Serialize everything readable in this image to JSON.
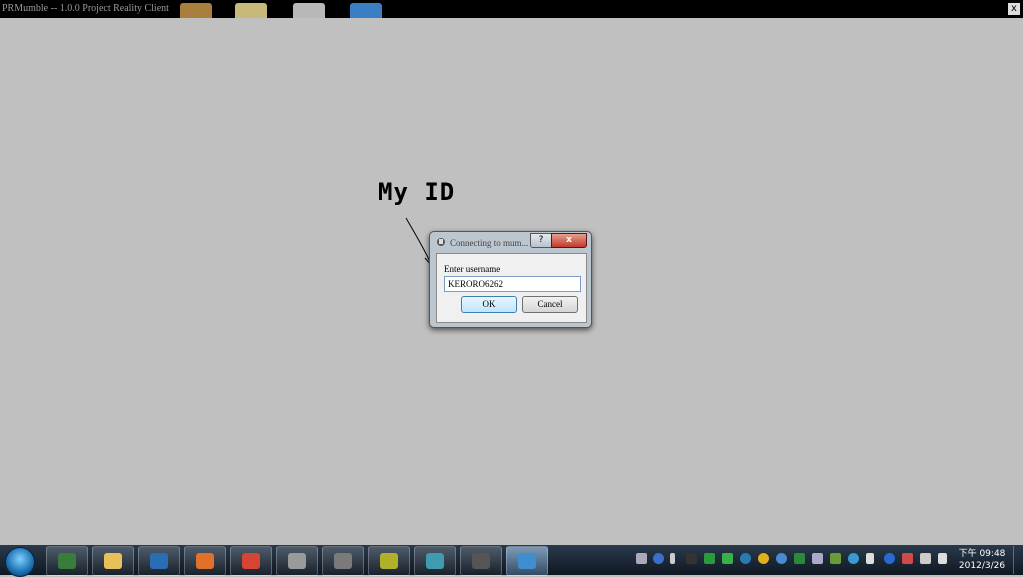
{
  "window": {
    "title": "PRMumble -- 1.0.0 Project Reality Client",
    "close_glyph": "x"
  },
  "annotation": {
    "text": "My ID"
  },
  "dialog": {
    "title": "Connecting to mum...",
    "help_glyph": "?",
    "close_glyph": "x",
    "label": "Enter username",
    "username_value": "KERORO6262",
    "ok_label": "OK",
    "cancel_label": "Cancel"
  },
  "taskbar": {
    "apps": [
      {
        "name": "remote-desktop",
        "color": "#3a7d3a"
      },
      {
        "name": "explorer",
        "color": "#e8c15a"
      },
      {
        "name": "vb",
        "color": "#2a6db5"
      },
      {
        "name": "firefox",
        "color": "#e0702a"
      },
      {
        "name": "chrome",
        "color": "#d64534"
      },
      {
        "name": "app-shield-1",
        "color": "#9a9a9a"
      },
      {
        "name": "app-shield-2",
        "color": "#7a7a7a"
      },
      {
        "name": "app-99",
        "color": "#b0b02a"
      },
      {
        "name": "app-teamspeak",
        "color": "#3f9bb0"
      },
      {
        "name": "app-console",
        "color": "#555555"
      },
      {
        "name": "prmumble",
        "color": "#3f8fd0",
        "active": true
      }
    ],
    "clock_time": "下午 09:48",
    "clock_date": "2012/3/26"
  }
}
